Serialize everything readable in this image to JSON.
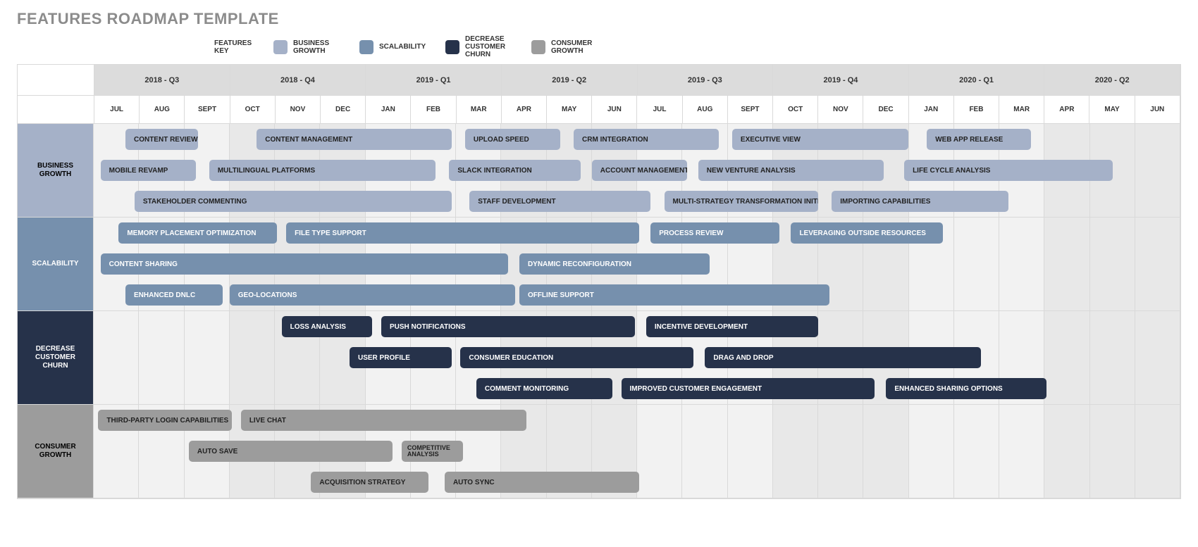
{
  "title": "FEATURES ROADMAP TEMPLATE",
  "legend": {
    "heading": "FEATURES KEY",
    "items": [
      {
        "label": "BUSINESS GROWTH",
        "color": "#a5b1c8",
        "class": "c-bg"
      },
      {
        "label": "SCALABILITY",
        "color": "#7690ad",
        "class": "c-sc"
      },
      {
        "label": "DECREASE CUSTOMER CHURN",
        "color": "#26324a",
        "class": "c-dc"
      },
      {
        "label": "CONSUMER GROWTH",
        "color": "#9c9c9c",
        "class": "c-cg"
      }
    ]
  },
  "timeline": {
    "quarters": [
      "2018 - Q3",
      "2018 - Q4",
      "2019 - Q1",
      "2019 - Q2",
      "2019 - Q3",
      "2019 - Q4",
      "2020 - Q1",
      "2020 - Q2"
    ],
    "months": [
      "JUL",
      "AUG",
      "SEPT",
      "OCT",
      "NOV",
      "DEC",
      "JAN",
      "FEB",
      "MAR",
      "APR",
      "MAY",
      "JUN",
      "JUL",
      "AUG",
      "SEPT",
      "OCT",
      "NOV",
      "DEC",
      "JAN",
      "FEB",
      "MAR",
      "APR",
      "MAY",
      "JUN"
    ]
  },
  "groups": [
    {
      "name": "BUSINESS GROWTH",
      "class": "g-bg",
      "bar_class": "c-bg",
      "lanes": [
        [
          {
            "label": "CONTENT REVIEW",
            "start": 0.7,
            "span": 1.6
          },
          {
            "label": "CONTENT MANAGEMENT",
            "start": 3.6,
            "span": 4.3
          },
          {
            "label": "UPLOAD SPEED",
            "start": 8.2,
            "span": 2.1
          },
          {
            "label": "CRM INTEGRATION",
            "start": 10.6,
            "span": 3.2
          },
          {
            "label": "EXECUTIVE VIEW",
            "start": 14.1,
            "span": 3.9
          },
          {
            "label": "WEB APP RELEASE",
            "start": 18.4,
            "span": 2.3
          }
        ],
        [
          {
            "label": "MOBILE REVAMP",
            "start": 0.15,
            "span": 2.1
          },
          {
            "label": "MULTILINGUAL PLATFORMS",
            "start": 2.55,
            "span": 5.0
          },
          {
            "label": "SLACK INTEGRATION",
            "start": 7.85,
            "span": 2.9
          },
          {
            "label": "ACCOUNT MANAGEMENT",
            "start": 11.0,
            "span": 2.1
          },
          {
            "label": "NEW VENTURE ANALYSIS",
            "start": 13.35,
            "span": 4.1
          },
          {
            "label": "LIFE CYCLE ANALYSIS",
            "start": 17.9,
            "span": 4.6
          }
        ],
        [
          {
            "label": "STAKEHOLDER COMMENTING",
            "start": 0.9,
            "span": 7.0
          },
          {
            "label": "STAFF DEVELOPMENT",
            "start": 8.3,
            "span": 4.0
          },
          {
            "label": "MULTI-STRATEGY TRANSFORMATION INITIATIVES",
            "start": 12.6,
            "span": 3.4
          },
          {
            "label": "IMPORTING CAPABILITIES",
            "start": 16.3,
            "span": 3.9
          }
        ]
      ]
    },
    {
      "name": "SCALABILITY",
      "class": "g-sc",
      "bar_class": "c-sc",
      "lanes": [
        [
          {
            "label": "MEMORY PLACEMENT OPTIMIZATION",
            "start": 0.55,
            "span": 3.5
          },
          {
            "label": "FILE TYPE SUPPORT",
            "start": 4.25,
            "span": 7.8
          },
          {
            "label": "PROCESS REVIEW",
            "start": 12.3,
            "span": 2.85
          },
          {
            "label": "LEVERAGING OUTSIDE RESOURCES",
            "start": 15.4,
            "span": 3.35
          }
        ],
        [
          {
            "label": "CONTENT SHARING",
            "start": 0.15,
            "span": 9.0
          },
          {
            "label": "DYNAMIC RECONFIGURATION",
            "start": 9.4,
            "span": 4.2
          }
        ],
        [
          {
            "label": "ENHANCED DNLC",
            "start": 0.7,
            "span": 2.15
          },
          {
            "label": "GEO-LOCATIONS",
            "start": 3.0,
            "span": 6.3
          },
          {
            "label": "OFFLINE SUPPORT",
            "start": 9.4,
            "span": 6.85
          }
        ]
      ]
    },
    {
      "name": "DECREASE CUSTOMER CHURN",
      "class": "g-dc",
      "bar_class": "c-dc",
      "lanes": [
        [
          {
            "label": "LOSS ANALYSIS",
            "start": 4.15,
            "span": 2.0
          },
          {
            "label": "PUSH NOTIFICATIONS",
            "start": 6.35,
            "span": 5.6
          },
          {
            "label": "INCENTIVE DEVELOPMENT",
            "start": 12.2,
            "span": 3.8
          }
        ],
        [
          {
            "label": "USER PROFILE",
            "start": 5.65,
            "span": 2.25
          },
          {
            "label": "CONSUMER EDUCATION",
            "start": 8.1,
            "span": 5.15
          },
          {
            "label": "DRAG AND DROP",
            "start": 13.5,
            "span": 6.1
          }
        ],
        [
          {
            "label": "COMMENT MONITORING",
            "start": 8.45,
            "span": 3.0
          },
          {
            "label": "IMPROVED CUSTOMER ENGAGEMENT",
            "start": 11.65,
            "span": 5.6
          },
          {
            "label": "ENHANCED SHARING OPTIONS",
            "start": 17.5,
            "span": 3.55
          }
        ]
      ]
    },
    {
      "name": "CONSUMER GROWTH",
      "class": "g-cg",
      "bar_class": "c-cg",
      "lanes": [
        [
          {
            "label": "THIRD-PARTY LOGIN CAPABILITIES",
            "start": 0.1,
            "span": 2.95
          },
          {
            "label": "LIVE CHAT",
            "start": 3.25,
            "span": 6.3
          }
        ],
        [
          {
            "label": "AUTO SAVE",
            "start": 2.1,
            "span": 4.5
          },
          {
            "label": "COMPETITIVE ANALYSIS",
            "start": 6.8,
            "span": 1.35,
            "small": true
          }
        ],
        [
          {
            "label": "ACQUISITION STRATEGY",
            "start": 4.8,
            "span": 2.6
          },
          {
            "label": "AUTO SYNC",
            "start": 7.75,
            "span": 4.3
          }
        ]
      ]
    }
  ]
}
